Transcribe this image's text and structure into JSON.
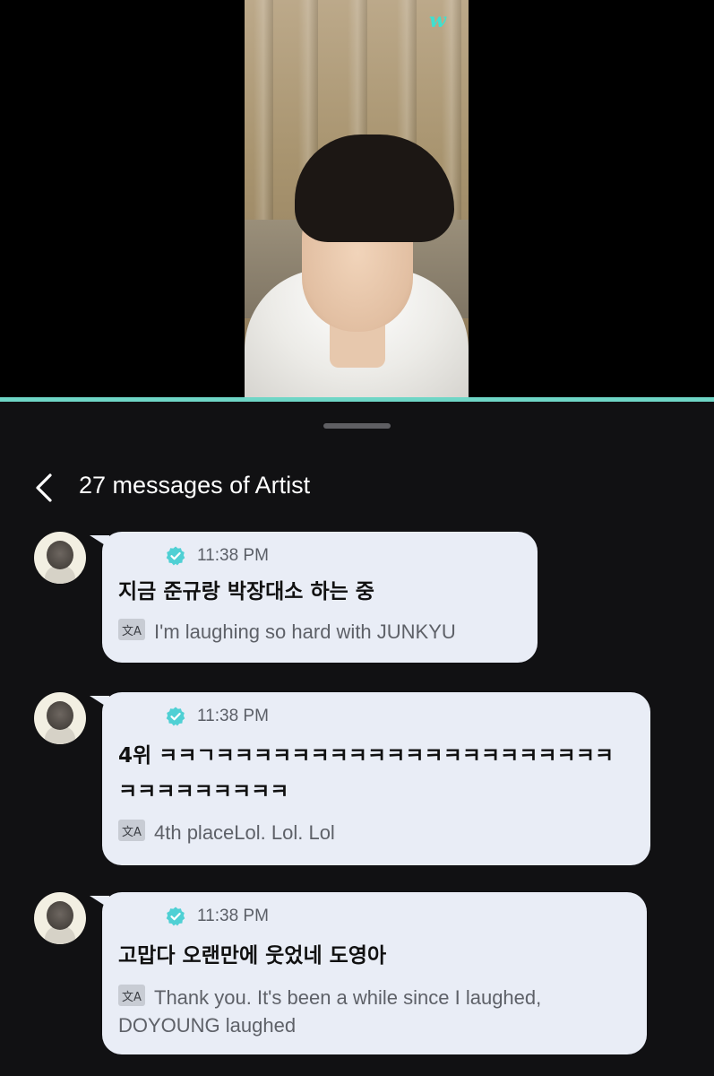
{
  "app": {
    "brand_mark": "w"
  },
  "chat": {
    "header_title": "27 messages of Artist"
  },
  "messages": [
    {
      "time": "11:38 PM",
      "text": "지금 준규랑 박장대소 하는 중",
      "translation": "I'm laughing so hard with JUNKYU"
    },
    {
      "time": "11:38 PM",
      "text_line1": "4위 ㅋㅋㄱㅋㅋㅋㅋㅋㅋㅋㅋㅋㅋㅋㅋㅋㅋㅋㅋㅋㅋㅋㅋㅋ",
      "text_line2": "ㅋㅋㅋㅋㅋㅋㅋㅋㅋ",
      "translation": "4th placeLol. Lol. Lol"
    },
    {
      "time": "11:38 PM",
      "text": "고맙다 오랜만에 웃었네 도영아",
      "translation_line1": "Thank you. It's been a while since I laughed,",
      "translation_line2": "DOYOUNG laughed"
    }
  ],
  "icons": {
    "back": "chevron-left-icon",
    "verified": "verified-badge-icon",
    "translate": "translate-icon"
  },
  "colors": {
    "accent": "#6fd6c6",
    "bubble": "#e9edf6",
    "verified": "#4fd0d4"
  }
}
